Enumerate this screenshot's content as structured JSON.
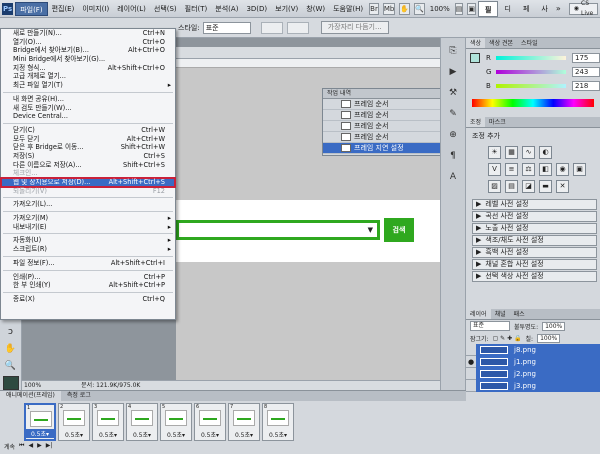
{
  "menubar": {
    "ps_logo": "Ps",
    "items": [
      "파일(F)",
      "편집(E)",
      "이미지(I)",
      "레이어(L)",
      "선택(S)",
      "필터(T)",
      "분석(A)",
      "3D(D)",
      "보기(V)",
      "창(W)",
      "도움말(H)"
    ],
    "zoom": "100%",
    "workspaces": [
      "필수",
      "디자인",
      "페인팅",
      "사진"
    ],
    "cslive": "CS Live"
  },
  "options": {
    "style_label": "스타일:",
    "style_value": "표준",
    "refine_button": "가장자리 다듬기..."
  },
  "filemenu": {
    "groups": [
      [
        {
          "label": "새로 만들기(N)...",
          "shortcut": "Ctrl+N"
        },
        {
          "label": "열기(O)...",
          "shortcut": "Ctrl+O"
        },
        {
          "label": "Bridge에서 찾아보기(B)...",
          "shortcut": "Alt+Ctrl+O"
        },
        {
          "label": "Mini Bridge에서 찾아보기(G)...",
          "shortcut": ""
        },
        {
          "label": "지정 형식...",
          "shortcut": "Alt+Shift+Ctrl+O"
        },
        {
          "label": "고급 개체로 열기...",
          "shortcut": ""
        },
        {
          "label": "최근 파일 열기(T)",
          "shortcut": "",
          "submenu": true
        }
      ],
      [
        {
          "label": "내 화면 공유(H)...",
          "shortcut": ""
        },
        {
          "label": "새 검토 만들기(W)...",
          "shortcut": ""
        },
        {
          "label": "Device Central...",
          "shortcut": ""
        }
      ],
      [
        {
          "label": "닫기(C)",
          "shortcut": "Ctrl+W"
        },
        {
          "label": "모두 닫기",
          "shortcut": "Alt+Ctrl+W"
        },
        {
          "label": "닫은 후 Bridge로 이동...",
          "shortcut": "Shift+Ctrl+W"
        },
        {
          "label": "저장(S)",
          "shortcut": "Ctrl+S"
        },
        {
          "label": "다른 이름으로 저장(A)...",
          "shortcut": "Shift+Ctrl+S"
        },
        {
          "label": "체크인...",
          "shortcut": "",
          "disabled": true
        },
        {
          "label": "웹 및 장치용으로 저장(D)...",
          "shortcut": "Alt+Shift+Ctrl+S",
          "highlight": true
        },
        {
          "label": "되돌리기(V)",
          "shortcut": "F12",
          "disabled": true
        }
      ],
      [
        {
          "label": "가져오기(L)...",
          "shortcut": ""
        }
      ],
      [
        {
          "label": "가져오기(M)",
          "shortcut": "",
          "submenu": true
        },
        {
          "label": "내보내기(E)",
          "shortcut": "",
          "submenu": true
        }
      ],
      [
        {
          "label": "자동화(U)",
          "shortcut": "",
          "submenu": true
        },
        {
          "label": "스크립트(R)",
          "shortcut": "",
          "submenu": true
        }
      ],
      [
        {
          "label": "파일 정보(F)...",
          "shortcut": "Alt+Shift+Ctrl+I"
        }
      ],
      [
        {
          "label": "인쇄(P)...",
          "shortcut": "Ctrl+P"
        },
        {
          "label": "한 부 인쇄(Y)",
          "shortcut": "Alt+Shift+Ctrl+P"
        }
      ],
      [
        {
          "label": "종료(X)",
          "shortcut": "Ctrl+Q"
        }
      ]
    ]
  },
  "history": {
    "title": "작업 내역",
    "rows": [
      "프레임 순서",
      "프레임 순서",
      "프레임 순서",
      "프레임 순서",
      "프레임 지연 설정"
    ]
  },
  "canvas": {
    "search_button": "검색",
    "status_zoom": "100%",
    "status_doc": "문서: 121.9K/975.0K"
  },
  "color_panel": {
    "tabs": [
      "색상",
      "색상 견본",
      "스타일"
    ],
    "r": "175",
    "g": "243",
    "b": "218",
    "r_label": "R",
    "g_label": "G",
    "b_label": "B"
  },
  "adjust_panel": {
    "tabs": [
      "조정",
      "마스크"
    ],
    "title": "조정 추가",
    "presets": [
      "레벨 사전 설정",
      "곡선 사전 설정",
      "노출 사전 설정",
      "색조/채도 사전 설정",
      "흑백 사전 설정",
      "채널 혼합 사전 설정",
      "선택 색상 사전 설정"
    ]
  },
  "layers_panel": {
    "tabs": [
      "레이어",
      "채널",
      "패스"
    ],
    "blend": "표준",
    "opacity_label": "불투명도:",
    "opacity": "100%",
    "fill_label": "칠:",
    "fill": "100%",
    "lock_label": "잠그기:",
    "layers": [
      "j8.png",
      "j1.png",
      "j2.png",
      "j3.png"
    ]
  },
  "anim_panel": {
    "tabs": [
      "애니메이션(프레임)",
      "측정 로그"
    ],
    "frames": [
      {
        "no": "1",
        "delay": "0.5초"
      },
      {
        "no": "2",
        "delay": "0.5초"
      },
      {
        "no": "3",
        "delay": "0.5초"
      },
      {
        "no": "4",
        "delay": "0.5초"
      },
      {
        "no": "5",
        "delay": "0.5초"
      },
      {
        "no": "6",
        "delay": "0.5초"
      },
      {
        "no": "7",
        "delay": "0.5초"
      },
      {
        "no": "8",
        "delay": "0.5초"
      }
    ],
    "loop": "계속"
  },
  "colors": {
    "accent": "#3a6bc4",
    "green": "#2fa81f",
    "highlight_border": "#c9213a"
  }
}
